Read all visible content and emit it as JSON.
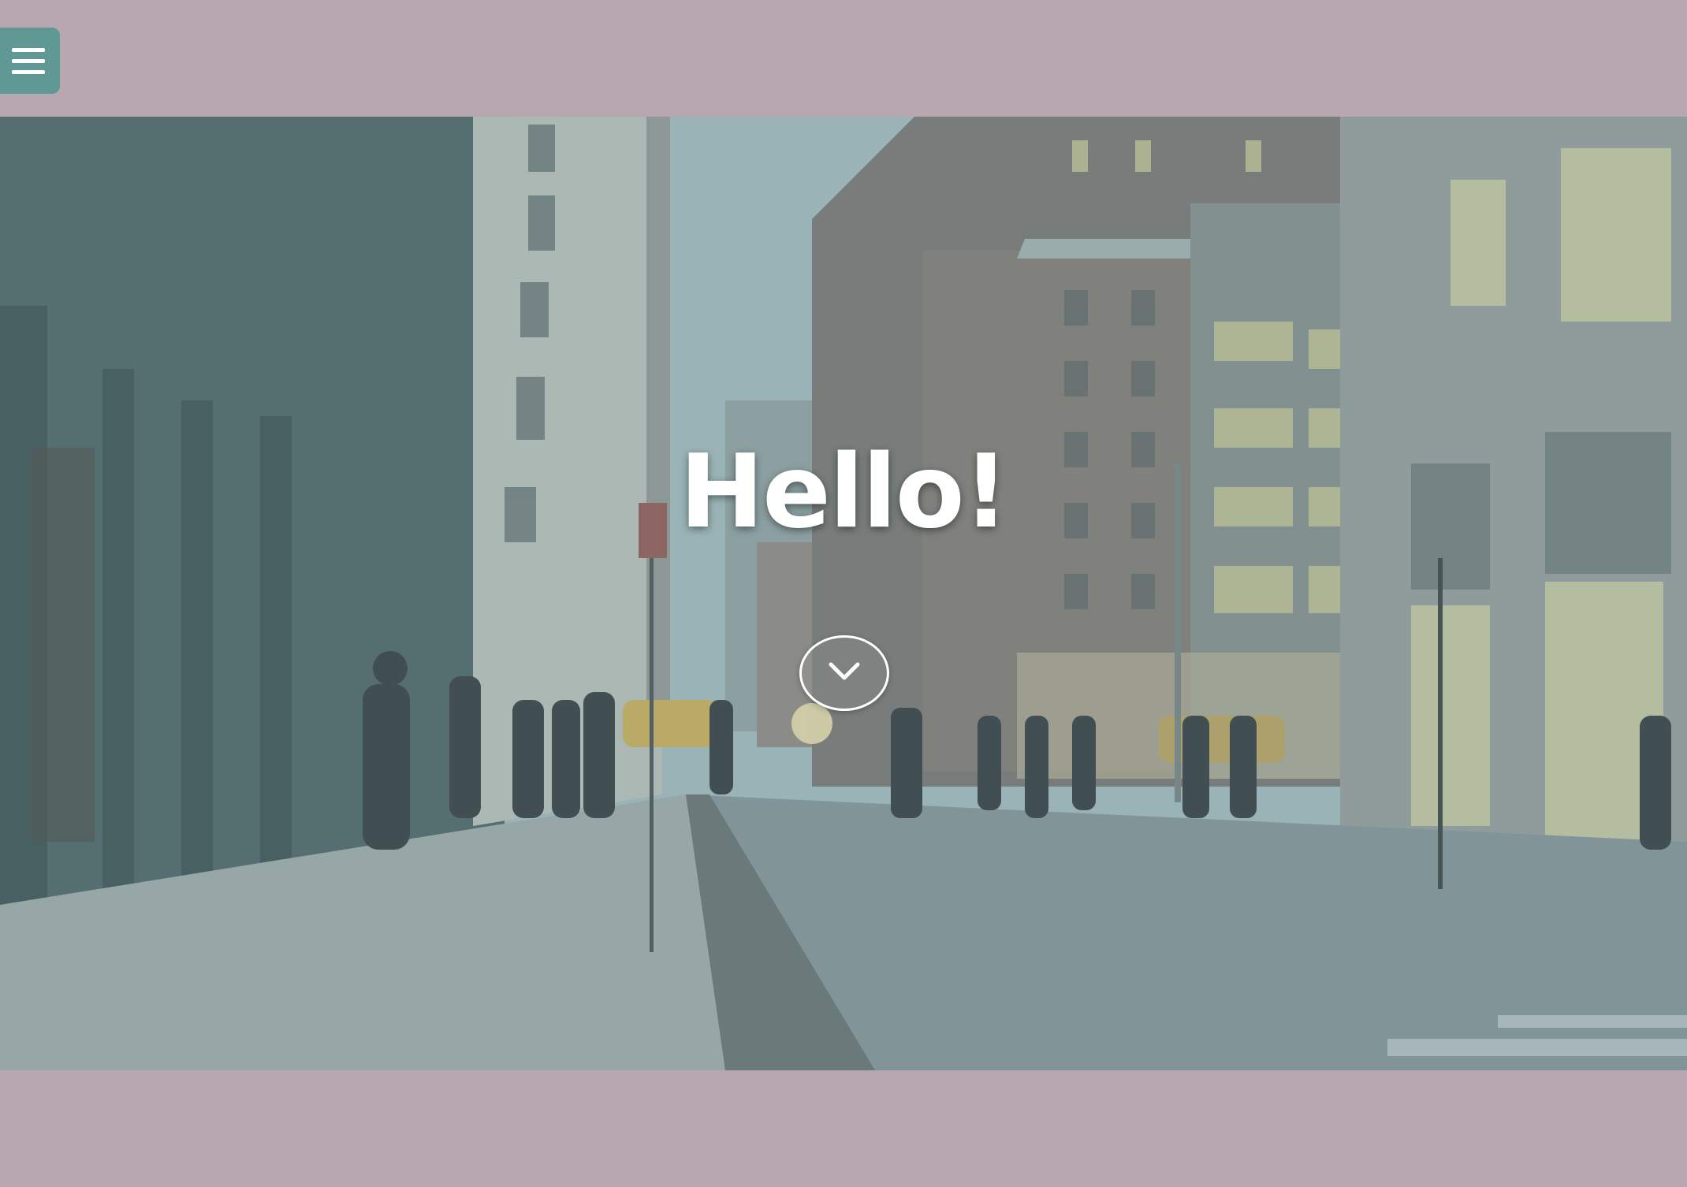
{
  "header": {
    "menu_icon": "hamburger-menu-icon",
    "menu_button_color": "#5f9895"
  },
  "hero": {
    "title": "Hello!",
    "scroll_icon": "chevron-down-icon",
    "background_description_color": "#7f979a",
    "overlay_color": "#8fb1b3"
  },
  "page": {
    "background_color": "#b7a7ae"
  }
}
